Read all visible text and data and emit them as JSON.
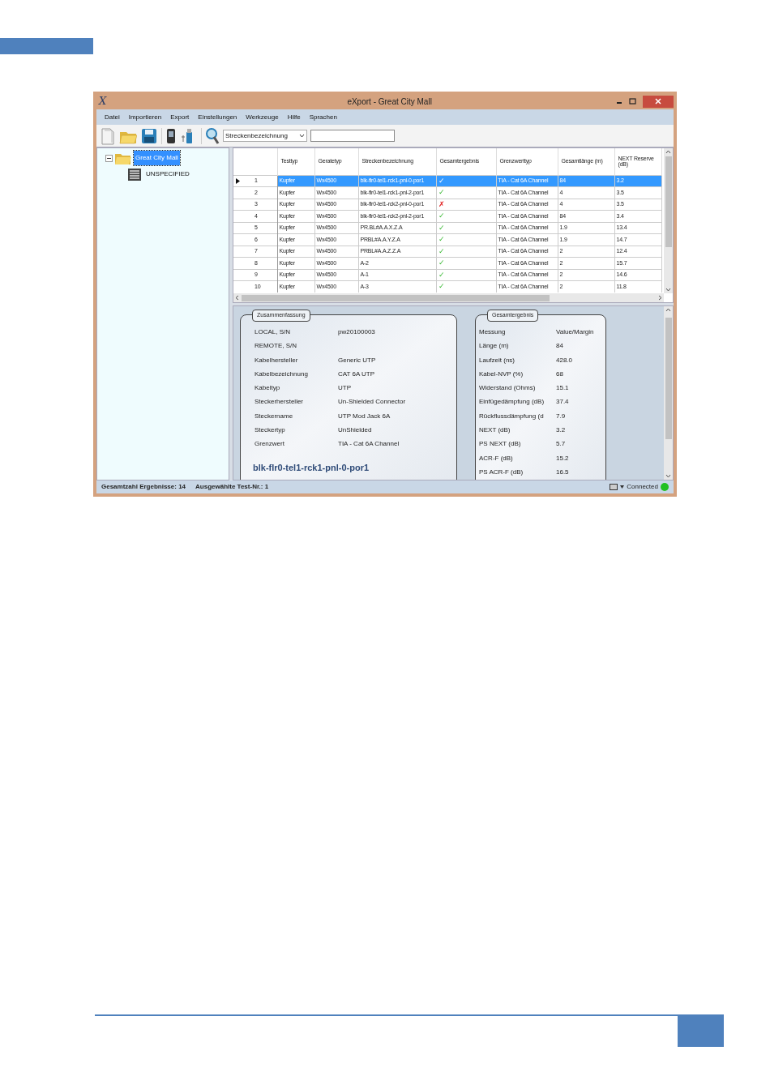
{
  "window": {
    "logo": "X",
    "title": "eXport - Great City Mall"
  },
  "menu": [
    "Datei",
    "Importieren",
    "Export",
    "Einstellungen",
    "Werkzeuge",
    "Hilfe",
    "Sprachen"
  ],
  "toolbar": {
    "search_by": "Streckenbezeichnung"
  },
  "tree": [
    {
      "label": "Great City Mall",
      "selected": true,
      "expanded": true,
      "children": [
        {
          "label": "UNSPECIFIED",
          "selected": false
        }
      ]
    }
  ],
  "table": {
    "columns": [
      "",
      "Testtyp",
      "Geratetyp",
      "Streckenbezeichnung",
      "Gesamtergebnis",
      "Grenzwerttyp",
      "Gesamtlänge (m)",
      "NEXT Reserve (dB)"
    ],
    "rows": [
      {
        "index": "1",
        "selected": true,
        "test_type": "Kupfer",
        "device": "Wx4500",
        "link": "blk-flr0-tel1-rck1-pnl-0-por1",
        "result": "✓",
        "kind": "pass",
        "limit": "TIA - Cat 6A Channel",
        "length": "84",
        "next": "3.2"
      },
      {
        "index": "2",
        "selected": false,
        "test_type": "Kupfer",
        "device": "Wx4500",
        "link": "blk-flr0-tel1-rck1-pnl-2-por1",
        "result": "✓",
        "kind": "pass",
        "limit": "TIA - Cat 6A Channel",
        "length": "4",
        "next": "3.5"
      },
      {
        "index": "3",
        "selected": false,
        "test_type": "Kupfer",
        "device": "Wx4500",
        "link": "blk-flr0-tel1-rck2-pnl-0-por1",
        "result": "✗",
        "kind": "fail",
        "limit": "TIA - Cat 6A Channel",
        "length": "4",
        "next": "3.5"
      },
      {
        "index": "4",
        "selected": false,
        "test_type": "Kupfer",
        "device": "Wx4500",
        "link": "blk-flr0-tel1-rck2-pnl-2-por1",
        "result": "✓",
        "kind": "pass",
        "limit": "TIA - Cat 6A Channel",
        "length": "84",
        "next": "3.4"
      },
      {
        "index": "5",
        "selected": false,
        "test_type": "Kupfer",
        "device": "Wx4500",
        "link": "PR.BL#A.A.X.Z.A",
        "result": "✓",
        "kind": "pass",
        "limit": "TIA - Cat 6A Channel",
        "length": "1.9",
        "next": "13.4"
      },
      {
        "index": "6",
        "selected": false,
        "test_type": "Kupfer",
        "device": "Wx4500",
        "link": "PRBL#A.A.Y.Z.A",
        "result": "✓",
        "kind": "pass",
        "limit": "TIA - Cat 6A Channel",
        "length": "1.9",
        "next": "14.7"
      },
      {
        "index": "7",
        "selected": false,
        "test_type": "Kupfer",
        "device": "Wx4500",
        "link": "PRBL#A.A.Z.Z.A",
        "result": "✓",
        "kind": "pass",
        "limit": "TIA - Cat 6A Channel",
        "length": "2",
        "next": "12.4"
      },
      {
        "index": "8",
        "selected": false,
        "test_type": "Kupfer",
        "device": "Wx4500",
        "link": "A-2",
        "result": "✓",
        "kind": "pass",
        "limit": "TIA - Cat 6A Channel",
        "length": "2",
        "next": "15.7"
      },
      {
        "index": "9",
        "selected": false,
        "test_type": "Kupfer",
        "device": "Wx4500",
        "link": "A-1",
        "result": "✓",
        "kind": "pass",
        "limit": "TIA - Cat 6A Channel",
        "length": "2",
        "next": "14.6"
      },
      {
        "index": "10",
        "selected": false,
        "test_type": "Kupfer",
        "device": "Wx4500",
        "link": "A-3",
        "result": "✓",
        "kind": "pass",
        "limit": "TIA - Cat 6A Channel",
        "length": "2",
        "next": "11.8"
      }
    ]
  },
  "summary": {
    "title": "Zusammenfassung",
    "rows": [
      {
        "label": "LOCAL, S/N",
        "value": "pw20100003"
      },
      {
        "label": "REMOTE, S/N"
      },
      {
        "label": "Kabelhersteller",
        "value": "Generic UTP"
      },
      {
        "label": "Kabelbezeichnung",
        "value": "CAT 6A UTP"
      },
      {
        "label": "Kabeltyp",
        "value": "UTP"
      },
      {
        "label": "Steckerhersteller",
        "value": "Un-Shielded Connector"
      },
      {
        "label": "Steckername",
        "value": "UTP Mod Jack 6A"
      },
      {
        "label": "Steckertyp",
        "value": "UnShielded"
      },
      {
        "label": "Grenzwert",
        "value": "TIA - Cat 6A Channel"
      }
    ],
    "link_name": "blk-flr0-tel1-rck1-pnl-0-por1"
  },
  "results": {
    "title": "Gesamtergebnis",
    "header": [
      "Messung",
      "Value/Margin"
    ],
    "rows": [
      {
        "label": "Länge (m)",
        "value": "84"
      },
      {
        "label": "Laufzeit (ns)",
        "value": "428.0"
      },
      {
        "label": "Kabel-NVP (%)",
        "value": "68"
      },
      {
        "label": "Widerstand (Ohms)",
        "value": "15.1"
      },
      {
        "label": "Einfügedämpfung (dB)",
        "value": "37.4"
      },
      {
        "label": "Rückflussdämpfung (d",
        "value": "7.9"
      },
      {
        "label": "NEXT (dB)",
        "value": "3.2"
      },
      {
        "label": "PS NEXT (dB)",
        "value": "5.7"
      },
      {
        "label": "ACR-F (dB)",
        "value": "15.2"
      },
      {
        "label": "PS ACR-F (dB)",
        "value": "16.5"
      }
    ]
  },
  "status_bar": {
    "total": "Gesamtzahl Ergebnisse: 14",
    "selected_test": "Ausgewählte Test-Nr.: 1",
    "connection": "Connected",
    "connected": true
  }
}
